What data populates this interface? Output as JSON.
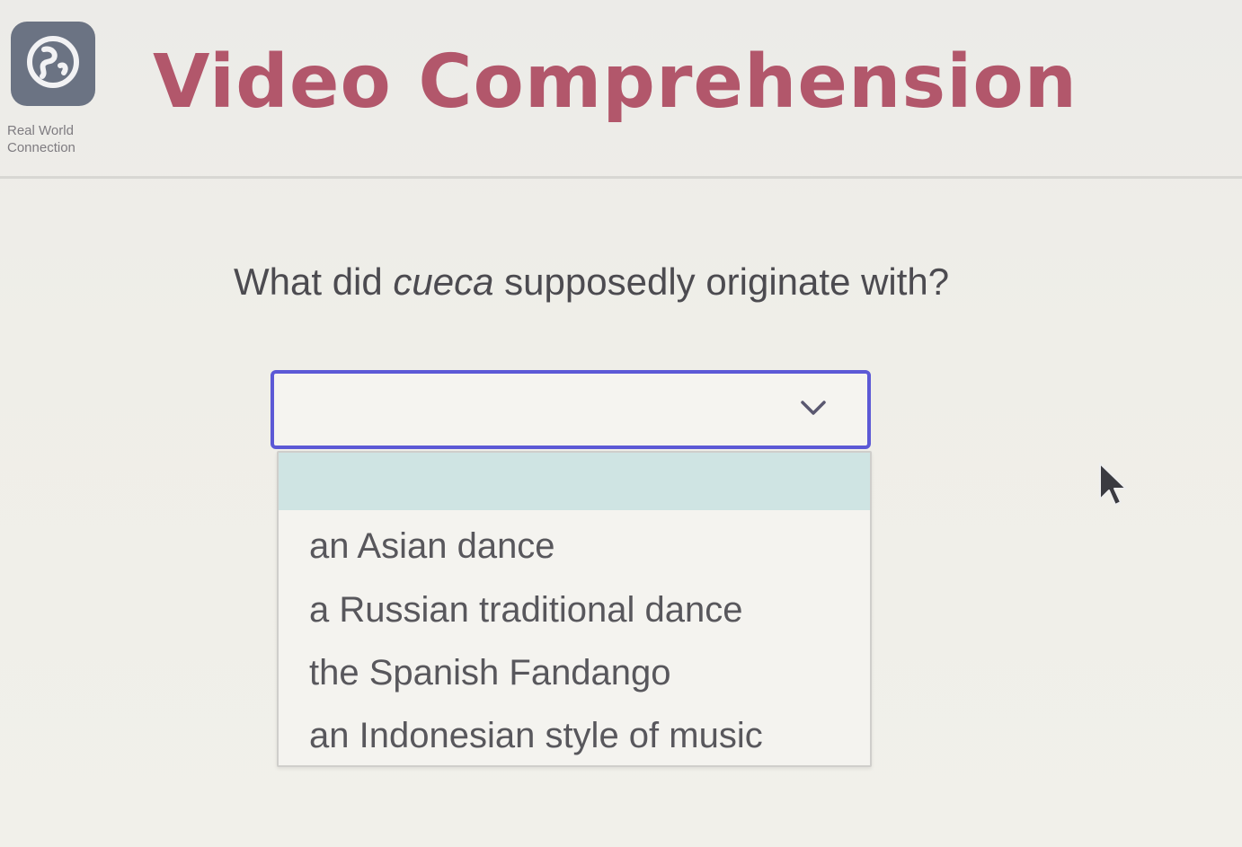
{
  "header": {
    "title": "Video Comprehension",
    "badge": {
      "icon": "globe-icon",
      "caption_line1": "Real World",
      "caption_line2": "Connection"
    }
  },
  "question": {
    "prefix": "What did ",
    "emphasis": "cueca",
    "suffix": " supposedly originate with?"
  },
  "select": {
    "selected_value": "",
    "options": [
      "",
      "an Asian dance",
      "a Russian traditional dance",
      "the Spanish Fandango",
      "an Indonesian style of music"
    ]
  },
  "colors": {
    "title": "#b2576b",
    "select_border": "#5c59d6",
    "highlight": "#cfe4e3",
    "badge": "#6b7383"
  }
}
